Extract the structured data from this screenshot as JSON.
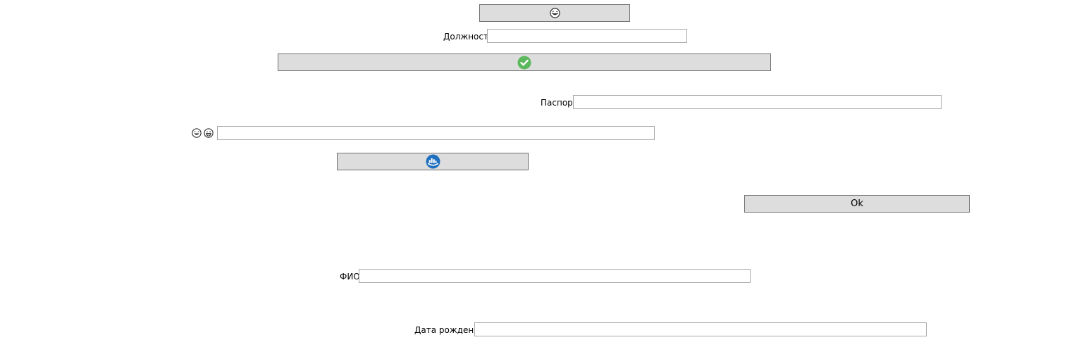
{
  "buttons": {
    "top_icon": "laughing-face-icon",
    "confirm_icon": "check-circle-icon",
    "city_icon": "city-globe-icon",
    "ok_label": "Ok"
  },
  "fields": {
    "position_label": "Должность",
    "passport_label": "Паспорт",
    "emoji_row_icons": [
      "laughing-face-icon",
      "grinning-face-icon"
    ],
    "fio_label": "ФИО",
    "birthdate_label": "Дата рождения",
    "position_value": "",
    "passport_value": "",
    "emoji_value": "",
    "fio_value": "",
    "birthdate_value": ""
  },
  "colors": {
    "button_bg": "#dddddd",
    "button_border": "#707070",
    "field_border": "#a8a8a8",
    "check_green": "#5cb85c",
    "city_blue": "#1f6fbf"
  }
}
